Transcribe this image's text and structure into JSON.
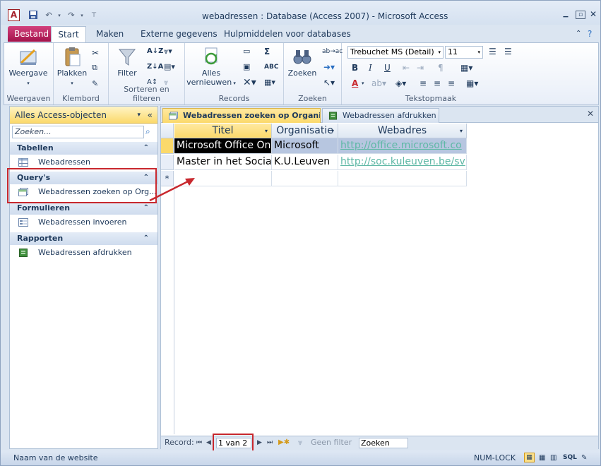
{
  "window": {
    "title": "webadressen : Database (Access 2007)  -  Microsoft Access"
  },
  "ribbon": {
    "tabs": [
      "Bestand",
      "Start",
      "Maken",
      "Externe gegevens",
      "Hulpmiddelen voor databases"
    ],
    "groups": {
      "weergaven": {
        "label": "Weergaven",
        "button": "Weergave"
      },
      "klembord": {
        "label": "Klembord",
        "button": "Plakken"
      },
      "sorteren": {
        "label": "Sorteren en filteren",
        "button": "Filter"
      },
      "records": {
        "label": "Records",
        "button_line1": "Alles",
        "button_line2": "vernieuwen"
      },
      "zoeken": {
        "label": "Zoeken",
        "button": "Zoeken"
      },
      "tekst": {
        "label": "Tekstopmaak",
        "font": "Trebuchet MS (Detail)",
        "size": "11"
      }
    }
  },
  "nav": {
    "header": "Alles Access-objecten",
    "search_placeholder": "Zoeken...",
    "sections": [
      {
        "title": "Tabellen",
        "items": [
          "Webadressen"
        ]
      },
      {
        "title": "Query's",
        "items": [
          "Webadressen zoeken op Org..."
        ]
      },
      {
        "title": "Formulieren",
        "items": [
          "Webadressen invoeren"
        ]
      },
      {
        "title": "Rapporten",
        "items": [
          "Webadressen afdrukken"
        ]
      }
    ]
  },
  "doc_tabs": [
    "Webadressen zoeken op Organisatie",
    "Webadressen afdrukken"
  ],
  "table": {
    "columns": [
      "Titel",
      "Organisatie",
      "Webadres"
    ],
    "rows": [
      [
        "Microsoft Office Onl",
        "Microsoft",
        "http://office.microsoft.co"
      ],
      [
        "Master in het Sociaa",
        "K.U.Leuven",
        "http://soc.kuleuven.be/sv"
      ]
    ],
    "new_row_marker": "*"
  },
  "record_bar": {
    "label": "Record:",
    "position": "1 van 2",
    "filter": "Geen filter",
    "search": "Zoeken"
  },
  "status": {
    "left": "Naam van de website",
    "numlock": "NUM-LOCK",
    "views": [
      "SQL"
    ]
  },
  "colors": {
    "accent": "#c8282e",
    "file_tab": "#b8195a",
    "selection": "#000000"
  }
}
